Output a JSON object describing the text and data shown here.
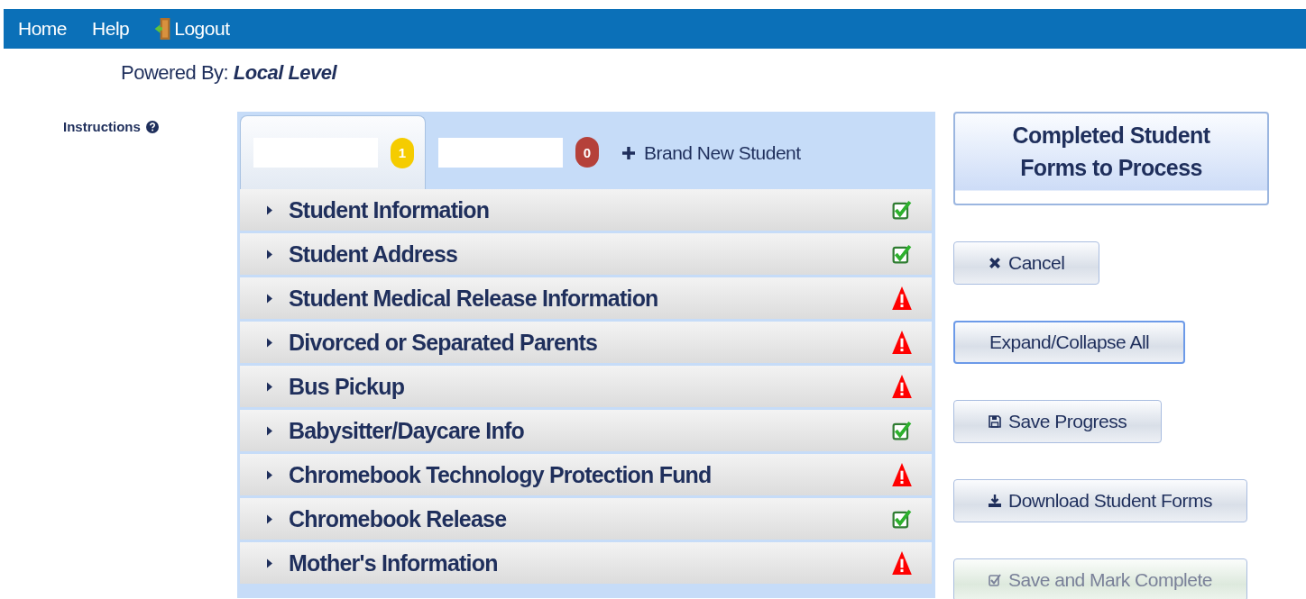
{
  "nav": [
    {
      "label": "Home",
      "kind": "link"
    },
    {
      "label": "Help",
      "kind": "link"
    },
    {
      "label": "Logout",
      "kind": "logout"
    }
  ],
  "powered_by": {
    "label": "Powered By:",
    "brand": "Local Level"
  },
  "instructions": {
    "label": "Instructions"
  },
  "tabs": [
    {
      "badge": "1",
      "color": "#f5cc00",
      "selected": true
    },
    {
      "badge": "0",
      "color": "#b5413a",
      "selected": false
    }
  ],
  "add_student": {
    "label": "Brand New Student"
  },
  "sections": [
    {
      "title": "Student Information",
      "kind": "complete"
    },
    {
      "title": "Student Address",
      "kind": "complete"
    },
    {
      "title": "Student Medical Release Information",
      "kind": "warning"
    },
    {
      "title": "Divorced or Separated Parents",
      "kind": "warning"
    },
    {
      "title": "Bus Pickup",
      "kind": "warning"
    },
    {
      "title": "Babysitter/Daycare Info",
      "kind": "complete"
    },
    {
      "title": "Chromebook Technology Protection Fund",
      "kind": "warning"
    },
    {
      "title": "Chromebook Release",
      "kind": "complete"
    },
    {
      "title": "Mother's Information",
      "kind": "warning"
    }
  ],
  "header_button": {
    "label": "Completed Student Forms to Process"
  },
  "buttons": [
    {
      "label": "Cancel",
      "kind": "cancel",
      "focused": false,
      "disabled": false
    },
    {
      "label": "Expand/Collapse All",
      "kind": "plain",
      "focused": true,
      "disabled": false
    },
    {
      "label": "Save Progress",
      "kind": "save",
      "focused": false,
      "disabled": false
    },
    {
      "label": "Download Student Forms",
      "kind": "download",
      "focused": false,
      "disabled": false
    },
    {
      "label": "Save and Mark Complete",
      "kind": "check",
      "focused": false,
      "disabled": true
    }
  ]
}
